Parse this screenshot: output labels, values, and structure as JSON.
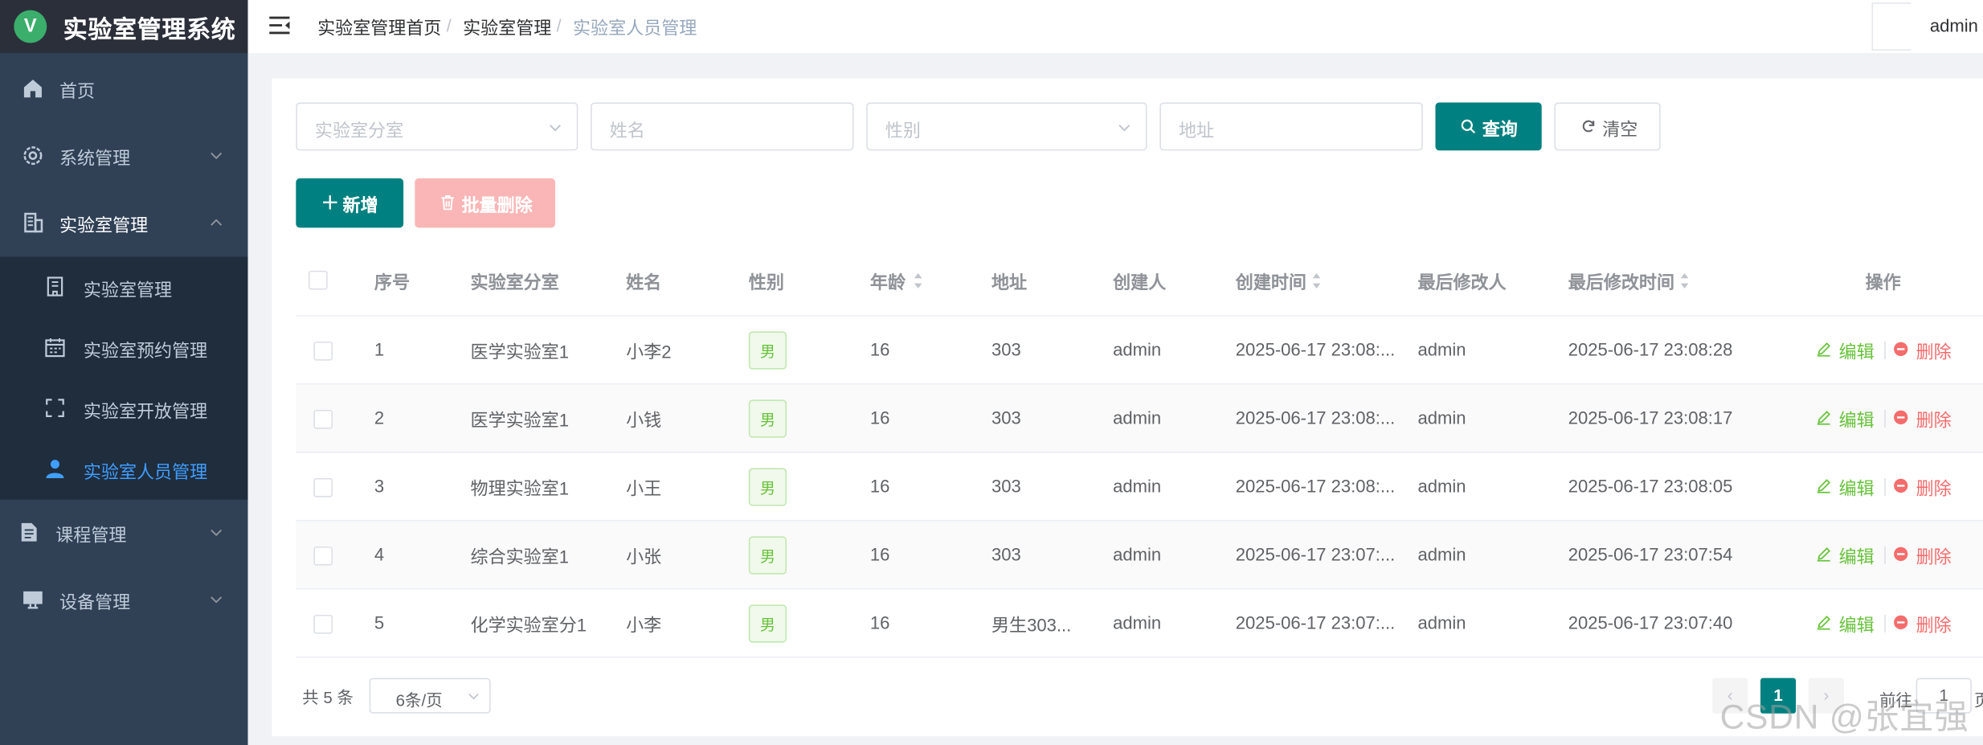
{
  "app": {
    "logo_letter": "V",
    "title": "实验室管理系统"
  },
  "colors": {
    "sidebar": "#304156",
    "logo_bar": "#2b2f3a",
    "submenu": "#1f2d3d",
    "primary": "#008080",
    "active_menu": "#409eff",
    "success": "#67c23a",
    "danger": "#f56c6c"
  },
  "sidebar": {
    "items": [
      {
        "label": "首页",
        "icon": "home-icon"
      },
      {
        "label": "系统管理",
        "icon": "gear-icon"
      },
      {
        "label": "实验室管理",
        "icon": "building-icon",
        "expanded": true
      },
      {
        "label": "课程管理",
        "icon": "document-icon"
      },
      {
        "label": "设备管理",
        "icon": "monitor-icon"
      }
    ],
    "lab_submenu": [
      {
        "label": "实验室管理",
        "icon": "office-icon"
      },
      {
        "label": "实验室预约管理",
        "icon": "calendar-icon"
      },
      {
        "label": "实验室开放管理",
        "icon": "fullscreen-icon"
      },
      {
        "label": "实验室人员管理",
        "icon": "user-icon",
        "active": true
      }
    ]
  },
  "header": {
    "breadcrumb": [
      "实验室管理首页",
      "实验室管理",
      "实验室人员管理"
    ],
    "separator": "/",
    "user": "admin"
  },
  "search": {
    "branch_placeholder": "实验室分室",
    "name_placeholder": "姓名",
    "gender_placeholder": "性别",
    "address_placeholder": "地址",
    "query_label": "查询",
    "clear_label": "清空"
  },
  "toolbar": {
    "add_label": "新增",
    "batch_delete_label": "批量删除"
  },
  "table": {
    "headers": {
      "index": "序号",
      "branch": "实验室分室",
      "name": "姓名",
      "gender": "性别",
      "age": "年龄",
      "address": "地址",
      "creator": "创建人",
      "created_at": "创建时间",
      "modifier": "最后修改人",
      "modified_at": "最后修改时间",
      "actions": "操作"
    },
    "edit_label": "编辑",
    "delete_label": "删除",
    "rows": [
      {
        "index": "1",
        "branch": "医学实验室1",
        "name": "小李2",
        "gender": "男",
        "age": "16",
        "address": "303",
        "creator": "admin",
        "created_at": "2025-06-17 23:08:...",
        "modifier": "admin",
        "modified_at": "2025-06-17 23:08:28"
      },
      {
        "index": "2",
        "branch": "医学实验室1",
        "name": "小钱",
        "gender": "男",
        "age": "16",
        "address": "303",
        "creator": "admin",
        "created_at": "2025-06-17 23:08:...",
        "modifier": "admin",
        "modified_at": "2025-06-17 23:08:17"
      },
      {
        "index": "3",
        "branch": "物理实验室1",
        "name": "小王",
        "gender": "男",
        "age": "16",
        "address": "303",
        "creator": "admin",
        "created_at": "2025-06-17 23:08:...",
        "modifier": "admin",
        "modified_at": "2025-06-17 23:08:05"
      },
      {
        "index": "4",
        "branch": "综合实验室1",
        "name": "小张",
        "gender": "男",
        "age": "16",
        "address": "303",
        "creator": "admin",
        "created_at": "2025-06-17 23:07:...",
        "modifier": "admin",
        "modified_at": "2025-06-17 23:07:54"
      },
      {
        "index": "5",
        "branch": "化学实验室分1",
        "name": "小李",
        "gender": "男",
        "age": "16",
        "address": "男生303...",
        "creator": "admin",
        "created_at": "2025-06-17 23:07:...",
        "modifier": "admin",
        "modified_at": "2025-06-17 23:07:40"
      }
    ]
  },
  "pagination": {
    "total_text": "共 5 条",
    "page_size": "6条/页",
    "current_page": "1",
    "prev": "‹",
    "next": "›",
    "goto_label": "前往",
    "goto_value": "1",
    "goto_unit": "页"
  },
  "watermark": "CSDN @张宜强"
}
